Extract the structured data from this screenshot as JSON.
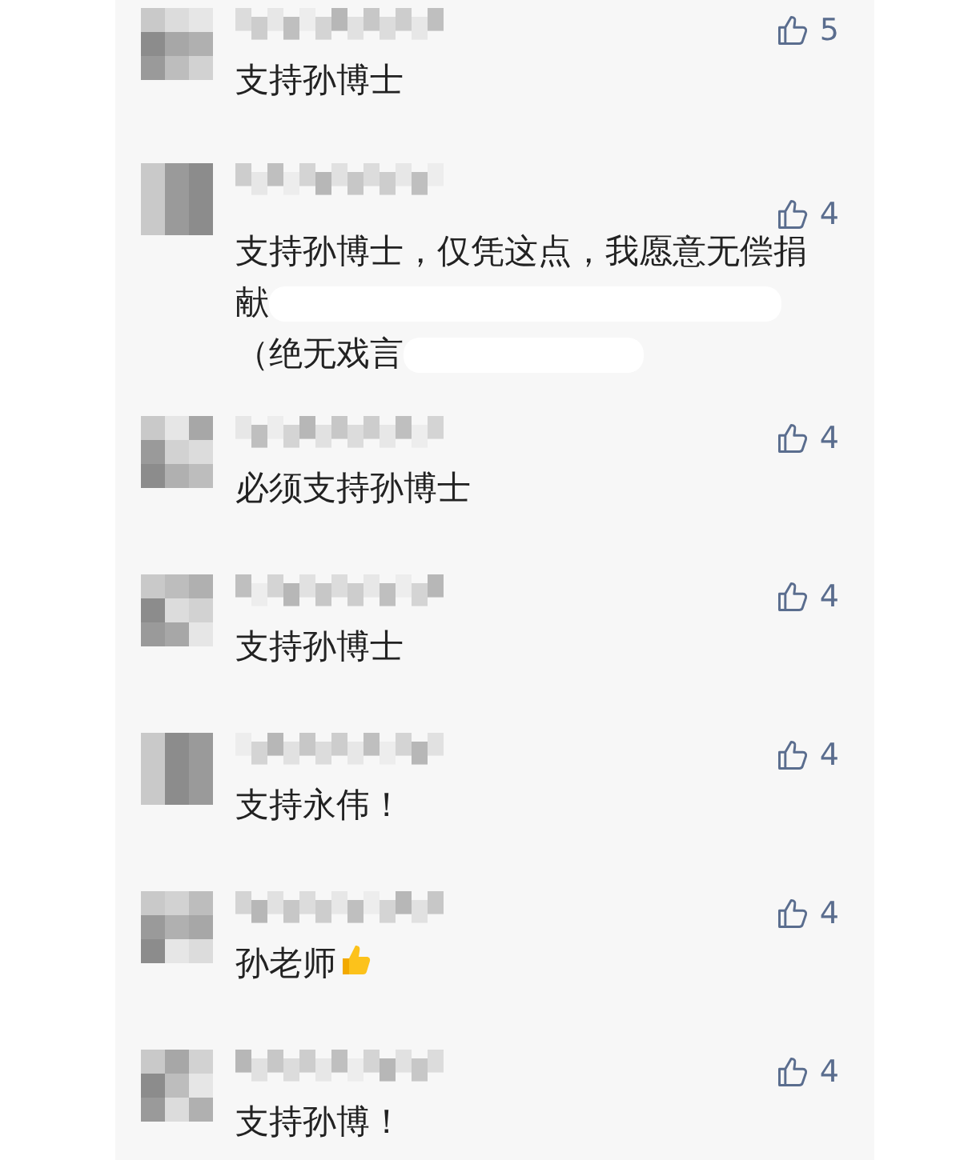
{
  "comments": [
    {
      "likes": "5",
      "parts": [
        {
          "kind": "text",
          "text": "支持孙博士"
        }
      ]
    },
    {
      "likes": "4",
      "parts": [
        {
          "kind": "text",
          "text": "支持孙博士，仅凭这点，我愿意无偿捐"
        },
        {
          "kind": "text",
          "text": "献"
        },
        {
          "kind": "redacted"
        },
        {
          "kind": "text",
          "text": "（绝无戏言"
        },
        {
          "kind": "redacted"
        }
      ]
    },
    {
      "likes": "4",
      "parts": [
        {
          "kind": "text",
          "text": "必须支持孙博士"
        }
      ]
    },
    {
      "likes": "4",
      "parts": [
        {
          "kind": "text",
          "text": "支持孙博士"
        }
      ]
    },
    {
      "likes": "4",
      "parts": [
        {
          "kind": "text",
          "text": "支持永伟！"
        }
      ]
    },
    {
      "likes": "4",
      "parts": [
        {
          "kind": "text",
          "text": "孙老师"
        },
        {
          "kind": "emoji"
        }
      ]
    },
    {
      "likes": "4",
      "parts": [
        {
          "kind": "text",
          "text": "支持孙博！"
        }
      ]
    }
  ]
}
